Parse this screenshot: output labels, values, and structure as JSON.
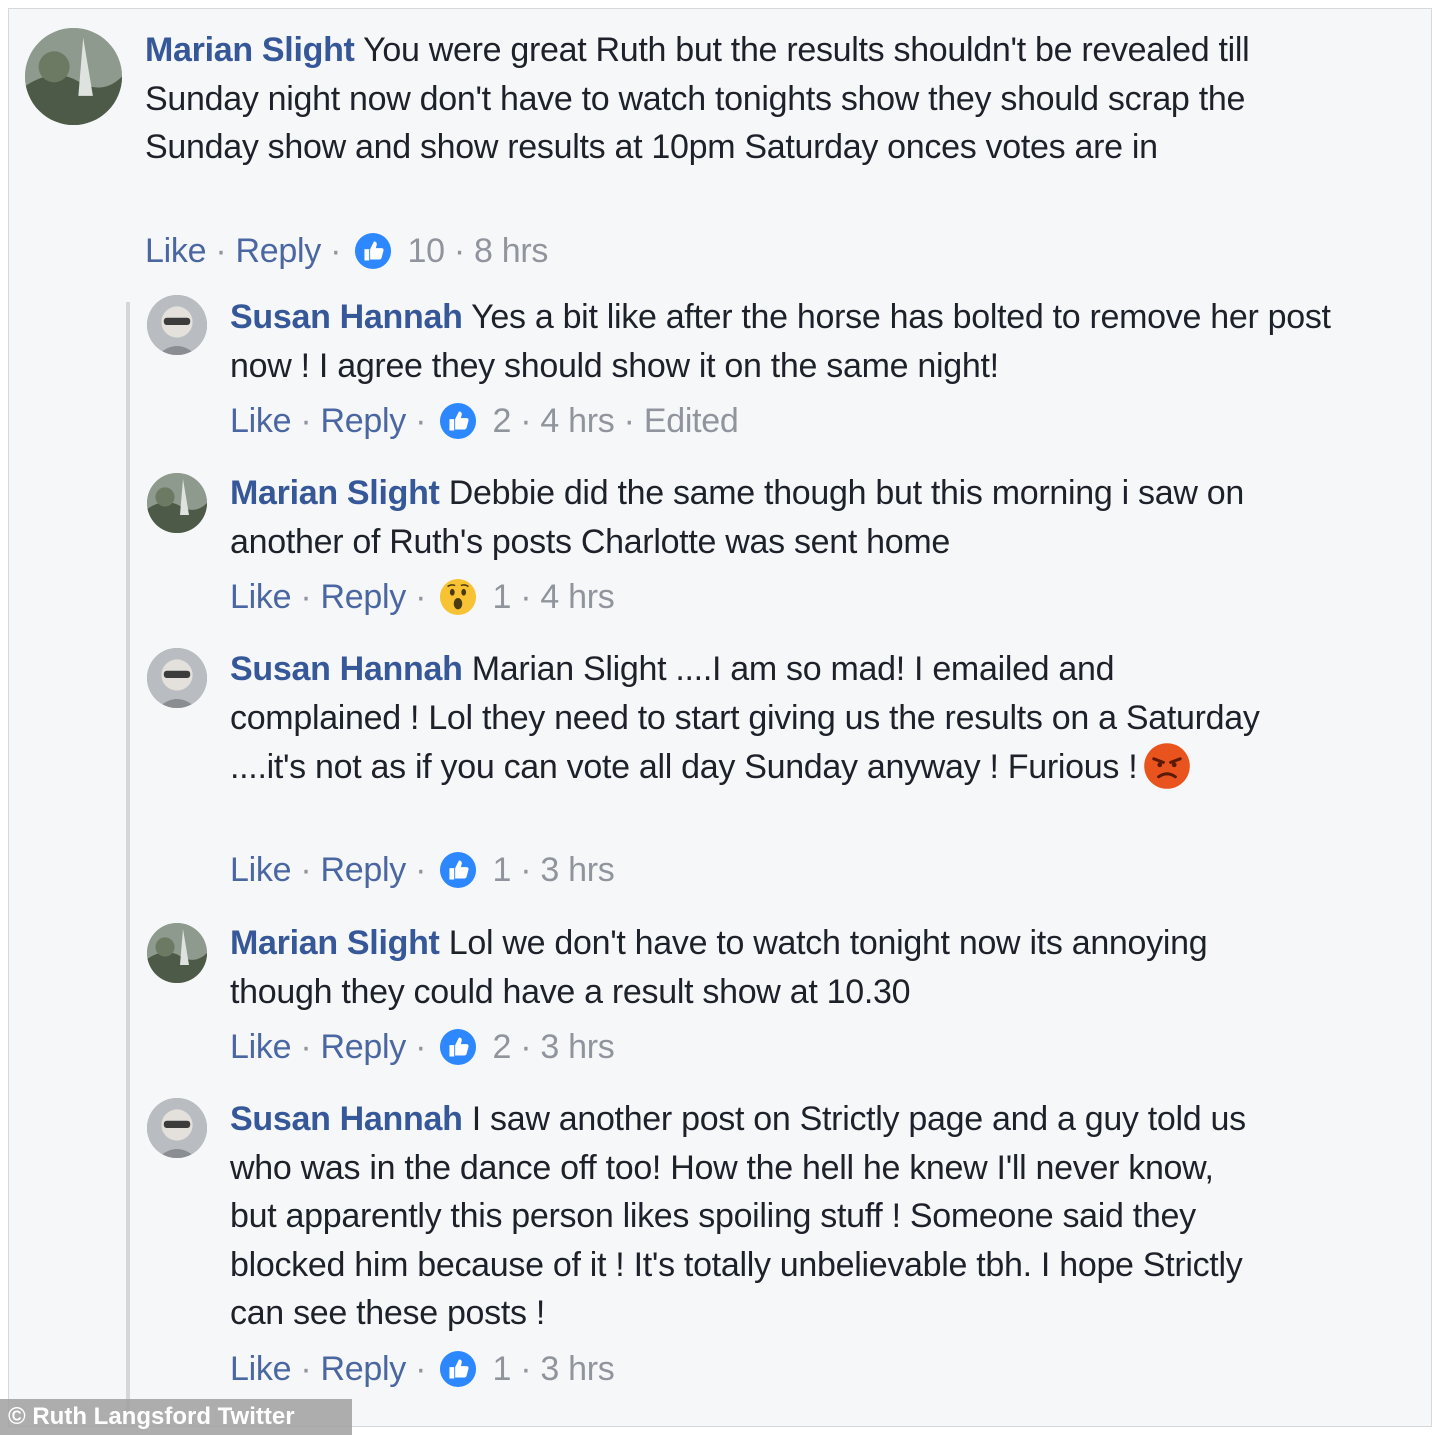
{
  "comments": [
    {
      "author": "Marian Slight",
      "text": "You were great Ruth but the results shouldn't be revealed till Sunday night now don't have to watch tonights show they should scrap the Sunday show and show results at 10pm Saturday onces votes are in",
      "like_label": "Like",
      "reply_label": "Reply",
      "reaction": "like-icon",
      "count": "10",
      "time": "8 hrs"
    },
    {
      "author": "Susan Hannah",
      "text": "Yes a bit like after the horse has bolted to remove her post now ! I agree they should show it on the same night!",
      "like_label": "Like",
      "reply_label": "Reply",
      "reaction": "like-icon",
      "count": "2",
      "time": "4 hrs",
      "edited": "Edited"
    },
    {
      "author": "Marian Slight",
      "text": "Debbie did the same though but this morning i saw on another of Ruth's posts Charlotte was sent home",
      "like_label": "Like",
      "reply_label": "Reply",
      "reaction": "wow-icon",
      "count": "1",
      "time": "4 hrs"
    },
    {
      "author": "Susan Hannah",
      "text": "Marian Slight ....I am so mad! I emailed and complained ! Lol they need to start giving us the results on a Saturday ....it's not as if you can vote all day Sunday anyway ! Furious !",
      "like_label": "Like",
      "reply_label": "Reply",
      "reaction": "like-icon",
      "count": "1",
      "time": "3 hrs",
      "inline_emoji": "angry-face-icon"
    },
    {
      "author": "Marian Slight",
      "text": "Lol we don't have to watch tonight now its annoying though they could have a result show at 10.30",
      "like_label": "Like",
      "reply_label": "Reply",
      "reaction": "like-icon",
      "count": "2",
      "time": "3 hrs"
    },
    {
      "author": "Susan Hannah",
      "text": "I saw another post on Strictly page and a guy told us who was in the dance off too! How the hell he knew I'll never know, but apparently this person likes spoiling stuff ! Someone said they blocked him because of it ! It's totally unbelievable tbh. I hope Strictly can see these posts !",
      "like_label": "Like",
      "reply_label": "Reply",
      "reaction": "like-icon",
      "count": "1",
      "time": "3 hrs"
    }
  ],
  "separator": "·",
  "watermark": "© Ruth Langsford Twitter",
  "colors": {
    "author": "#365899",
    "link": "#4b67a1",
    "meta": "#90949c",
    "like_blue": "#2d88ff",
    "wow_yellow": "#f7c234",
    "angry_orange": "#e9541e"
  }
}
